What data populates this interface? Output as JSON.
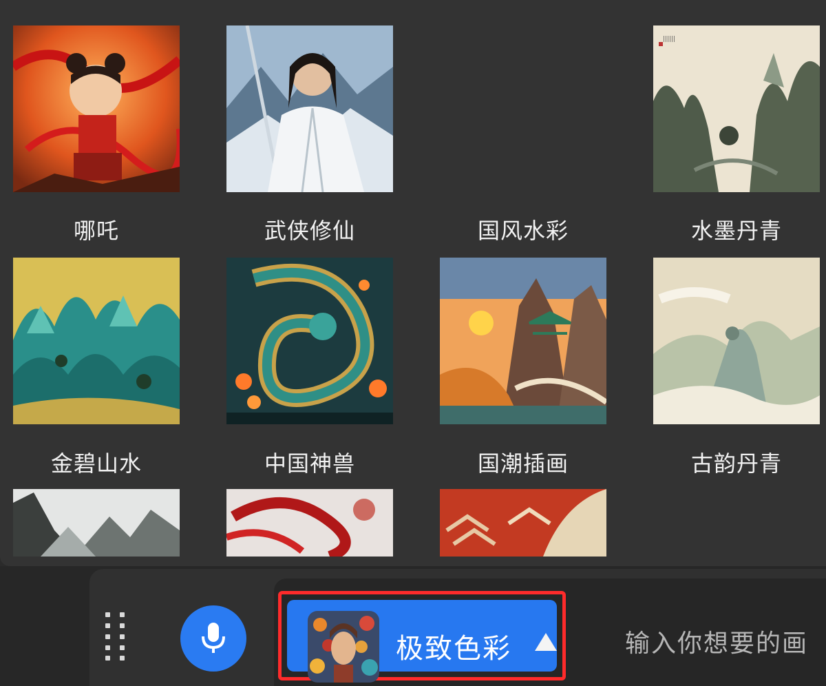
{
  "header": {
    "title_partial": ""
  },
  "styles": {
    "row1": [
      "哪吒",
      "武侠修仙",
      "国风水彩",
      "水墨丹青"
    ],
    "row2": [
      "金碧山水",
      "中国神兽",
      "国潮插画",
      "古韵丹青"
    ]
  },
  "toolbar": {
    "grip_icon": "grip-dots-icon",
    "mic_icon": "microphone-icon",
    "selected_style": "极致色彩",
    "caret_icon": "caret-up-icon",
    "prompt_placeholder": "输入你想要的画"
  },
  "colors": {
    "accent": "#2778f0",
    "highlight_border": "#ff2b2b",
    "panel": "#333333"
  }
}
